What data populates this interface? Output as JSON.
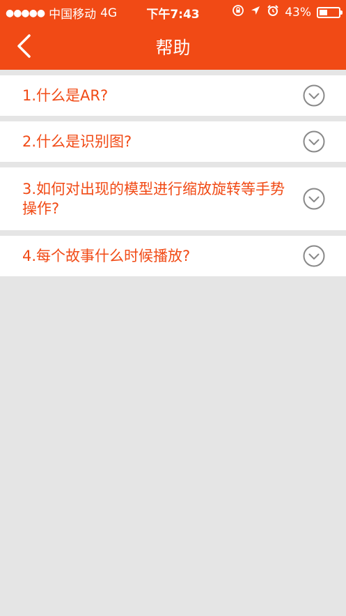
{
  "status_bar": {
    "signal": "●●●●●",
    "carrier": "中国移动",
    "network": "4G",
    "time": "下午7:43",
    "lock_icon": "orientation-lock-icon",
    "location_icon": "location-arrow-icon",
    "alarm_icon": "alarm-clock-icon",
    "battery_percent": "43%",
    "battery_level": 0.43
  },
  "nav": {
    "title": "帮助",
    "back_icon": "chevron-left-icon"
  },
  "faq": {
    "items": [
      {
        "text": "1.什么是AR?"
      },
      {
        "text": "2.什么是识别图?"
      },
      {
        "text": "3.如何对出现的模型进行缩放旋转等手势操作?"
      },
      {
        "text": "4.每个故事什么时候播放?"
      }
    ]
  },
  "colors": {
    "brand": "#f14a15",
    "background": "#e5e5e5",
    "card": "#ffffff",
    "icon_gray": "#888888"
  }
}
